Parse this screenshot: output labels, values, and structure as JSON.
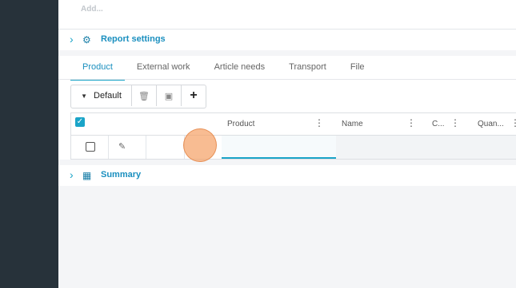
{
  "sidebar": {},
  "top": {
    "add_label": "Add..."
  },
  "report_settings": {
    "label": "Report settings",
    "icon": "gears-icon"
  },
  "tabs": [
    {
      "label": "Product",
      "active": true
    },
    {
      "label": "External work"
    },
    {
      "label": "Article needs"
    },
    {
      "label": "Transport"
    },
    {
      "label": "File"
    }
  ],
  "toolbar": {
    "view_label": "Default"
  },
  "grid": {
    "columns": [
      {
        "label": "Product"
      },
      {
        "label": "Name"
      },
      {
        "label": "C..."
      },
      {
        "label": "Quan..."
      }
    ]
  },
  "summary": {
    "label": "Summary",
    "icon": "calculator-icon"
  },
  "colors": {
    "accent": "#1aa4c8",
    "sidebar": "#27323a",
    "cursor": "#f5a064"
  }
}
